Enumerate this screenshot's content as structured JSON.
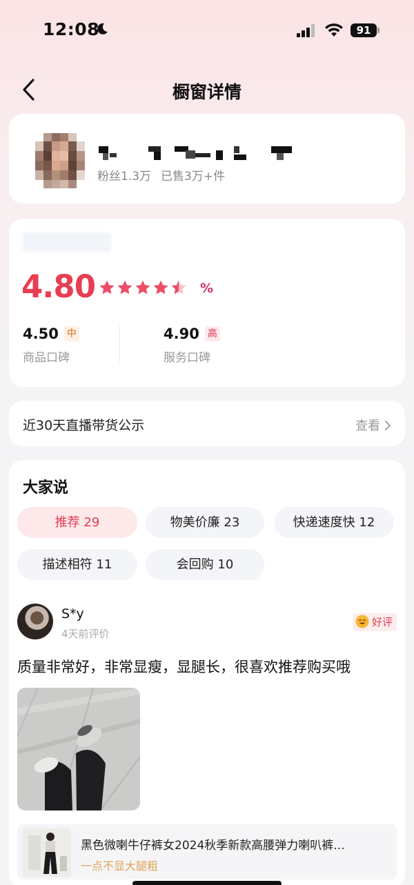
{
  "status_bar": {
    "time": "12:08",
    "battery": "91"
  },
  "nav": {
    "title": "橱窗详情"
  },
  "shop": {
    "fans": "粉丝1.3万",
    "sold": "已售3万+件"
  },
  "rating": {
    "score": "4.80",
    "stars": 4.5,
    "percent_suffix": "%",
    "product": {
      "value": "4.50",
      "level": "中",
      "label": "商品口碑"
    },
    "service": {
      "value": "4.90",
      "level": "高",
      "label": "服务口碑"
    }
  },
  "notice": {
    "text": "近30天直播带货公示",
    "link": "查看"
  },
  "reviews": {
    "title": "大家说",
    "tags": [
      {
        "label": "推荐 29"
      },
      {
        "label": "物美价廉 23"
      },
      {
        "label": "快递速度快 12"
      },
      {
        "label": "描述相符 11"
      },
      {
        "label": "会回购 10"
      }
    ],
    "item": {
      "name": "S*y",
      "time": "4天前评价",
      "badge": "好评",
      "text": "质量非常好，非常显瘦，显腿长，很喜欢推荐购买哦",
      "product_title": "黑色微喇牛仔裤女2024秋季新款高腰弹力喇叭裤...",
      "product_sub": "一点不显大腿粗"
    }
  },
  "colors": {
    "accent": "#e83e52",
    "badge_mid": "#e06a1b",
    "badge_high": "#d8314a"
  }
}
